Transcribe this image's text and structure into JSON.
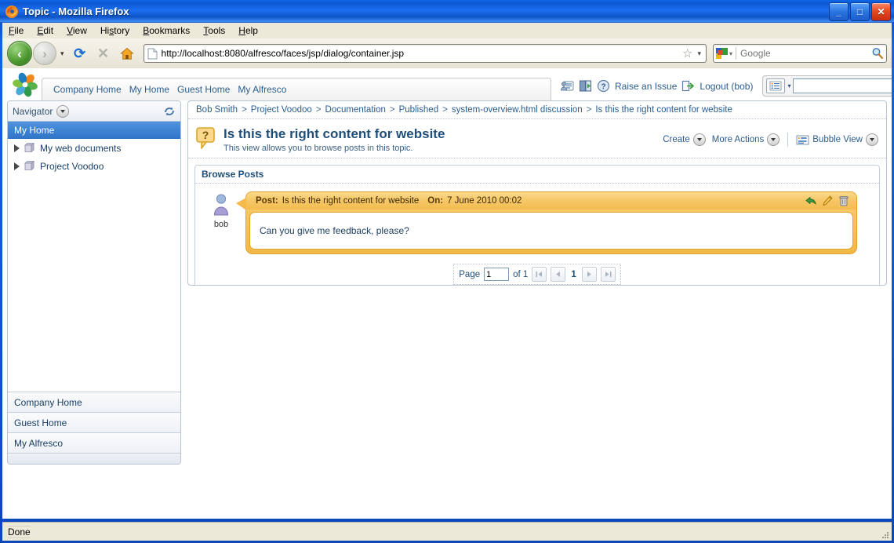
{
  "window": {
    "title": "Topic - Mozilla Firefox",
    "minimize_label": "_",
    "maximize_label": "□",
    "close_label": "✕"
  },
  "menubar": [
    {
      "label": "File",
      "accel": "F"
    },
    {
      "label": "Edit",
      "accel": "E"
    },
    {
      "label": "View",
      "accel": "V"
    },
    {
      "label": "History",
      "accel": "s"
    },
    {
      "label": "Bookmarks",
      "accel": "B"
    },
    {
      "label": "Tools",
      "accel": "T"
    },
    {
      "label": "Help",
      "accel": "H"
    }
  ],
  "navbar": {
    "url": "http://localhost:8080/alfresco/faces/jsp/dialog/container.jsp",
    "search_placeholder": "Google",
    "search_value": "",
    "back_glyph": "‹",
    "forward_glyph": "›",
    "reload_glyph": "⟳",
    "stop_glyph": "✕",
    "star_glyph": "☆",
    "dropdown_glyph": "▾"
  },
  "alfresco_header": {
    "nav_links": [
      "Company Home",
      "My Home",
      "Guest Home",
      "My Alfresco"
    ],
    "raise_issue_label": "Raise an Issue",
    "logout_label": "Logout (bob)",
    "search_value": "",
    "icons": [
      "user-details-icon",
      "my-alfresco-icon",
      "help-icon"
    ]
  },
  "sidebar": {
    "title": "Navigator",
    "selected_item": "My Home",
    "tree_items": [
      {
        "label": "My web documents"
      },
      {
        "label": "Project Voodoo"
      }
    ],
    "shortcuts": [
      "Company Home",
      "Guest Home",
      "My Alfresco"
    ]
  },
  "breadcrumb": {
    "separator": ">",
    "segments": [
      "Bob Smith",
      "Project Voodoo",
      "Documentation",
      "Published",
      "system-overview.html discussion",
      "Is this the right content for website"
    ]
  },
  "page": {
    "title": "Is this the right content for website",
    "subtitle": "This view allows you to browse posts in this topic."
  },
  "actions": [
    {
      "label": "Create",
      "name": "create-action"
    },
    {
      "label": "More Actions",
      "name": "more-actions-action"
    },
    {
      "label": "Bubble View",
      "name": "bubble-view-action"
    }
  ],
  "posts_panel": {
    "heading": "Browse Posts",
    "post": {
      "author": "bob",
      "post_label": "Post:",
      "post_title": "Is this the right content for website",
      "on_label": "On:",
      "date": "7 June 2010 00:02",
      "body": "Can you give me feedback, please?",
      "actions": [
        "reply-icon",
        "edit-icon",
        "delete-icon"
      ]
    }
  },
  "pager": {
    "page_label": "Page",
    "page_value": "1",
    "of_label": "of 1",
    "current_page": "1",
    "first_glyph": "❙◂",
    "prev_glyph": "◂",
    "next_glyph": "▸",
    "last_glyph": "▸❙"
  },
  "statusbar": {
    "text": "Done"
  },
  "colors": {
    "title_blue": "#0b4fcb",
    "link_blue": "#2a5d8f",
    "selection_blue": "#2f74c8",
    "bubble_gold": "#f3bc4e",
    "heading_blue": "#1f4e79"
  }
}
